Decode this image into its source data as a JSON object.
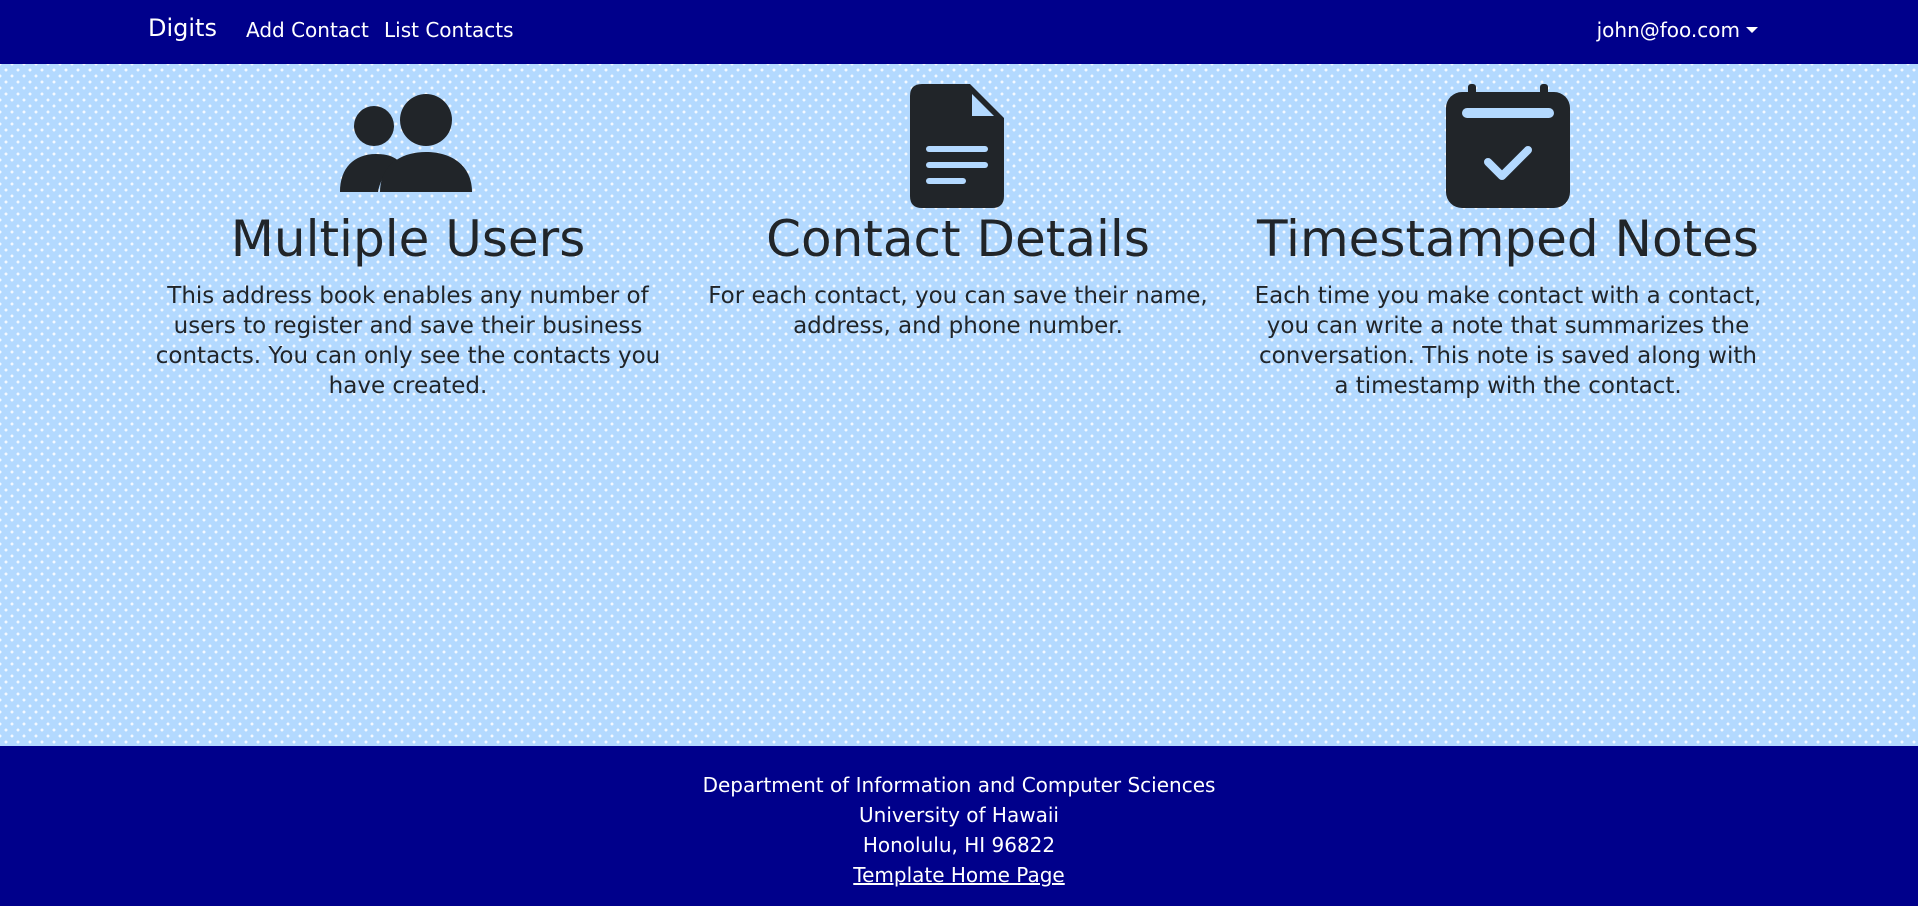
{
  "navbar": {
    "brand": "Digits",
    "links": [
      "Add Contact",
      "List Contacts"
    ],
    "user": "john@foo.com"
  },
  "features": [
    {
      "icon": "users-icon",
      "title": "Multiple Users",
      "text": "This address book enables any number of users to register and save their business contacts. You can only see the contacts you have created."
    },
    {
      "icon": "file-icon",
      "title": "Contact Details",
      "text": "For each contact, you can save their name, address, and phone number."
    },
    {
      "icon": "calendar-check-icon",
      "title": "Timestamped Notes",
      "text": "Each time you make contact with a contact, you can write a note that summarizes the conversation. This note is saved along with a timestamp with the contact."
    }
  ],
  "footer": {
    "lines": [
      "Department of Information and Computer Sciences",
      "University of Hawaii",
      "Honolulu, HI 96822"
    ],
    "link": "Template Home Page"
  },
  "colors": {
    "navbar_bg": "#00008b",
    "main_bg": "#b3d9ff",
    "text_dark": "#212529",
    "footer_bg": "#00008b"
  }
}
